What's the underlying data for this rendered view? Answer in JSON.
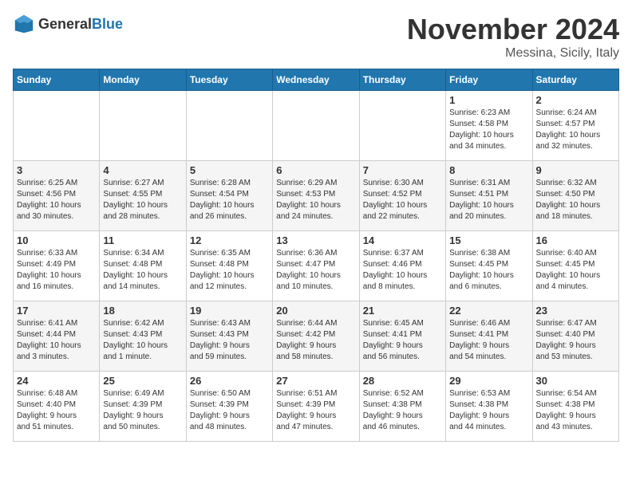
{
  "logo": {
    "text_general": "General",
    "text_blue": "Blue"
  },
  "title": "November 2024",
  "subtitle": "Messina, Sicily, Italy",
  "days_of_week": [
    "Sunday",
    "Monday",
    "Tuesday",
    "Wednesday",
    "Thursday",
    "Friday",
    "Saturday"
  ],
  "weeks": [
    [
      {
        "day": "",
        "lines": []
      },
      {
        "day": "",
        "lines": []
      },
      {
        "day": "",
        "lines": []
      },
      {
        "day": "",
        "lines": []
      },
      {
        "day": "",
        "lines": []
      },
      {
        "day": "1",
        "lines": [
          "Sunrise: 6:23 AM",
          "Sunset: 4:58 PM",
          "Daylight: 10 hours",
          "and 34 minutes."
        ]
      },
      {
        "day": "2",
        "lines": [
          "Sunrise: 6:24 AM",
          "Sunset: 4:57 PM",
          "Daylight: 10 hours",
          "and 32 minutes."
        ]
      }
    ],
    [
      {
        "day": "3",
        "lines": [
          "Sunrise: 6:25 AM",
          "Sunset: 4:56 PM",
          "Daylight: 10 hours",
          "and 30 minutes."
        ]
      },
      {
        "day": "4",
        "lines": [
          "Sunrise: 6:27 AM",
          "Sunset: 4:55 PM",
          "Daylight: 10 hours",
          "and 28 minutes."
        ]
      },
      {
        "day": "5",
        "lines": [
          "Sunrise: 6:28 AM",
          "Sunset: 4:54 PM",
          "Daylight: 10 hours",
          "and 26 minutes."
        ]
      },
      {
        "day": "6",
        "lines": [
          "Sunrise: 6:29 AM",
          "Sunset: 4:53 PM",
          "Daylight: 10 hours",
          "and 24 minutes."
        ]
      },
      {
        "day": "7",
        "lines": [
          "Sunrise: 6:30 AM",
          "Sunset: 4:52 PM",
          "Daylight: 10 hours",
          "and 22 minutes."
        ]
      },
      {
        "day": "8",
        "lines": [
          "Sunrise: 6:31 AM",
          "Sunset: 4:51 PM",
          "Daylight: 10 hours",
          "and 20 minutes."
        ]
      },
      {
        "day": "9",
        "lines": [
          "Sunrise: 6:32 AM",
          "Sunset: 4:50 PM",
          "Daylight: 10 hours",
          "and 18 minutes."
        ]
      }
    ],
    [
      {
        "day": "10",
        "lines": [
          "Sunrise: 6:33 AM",
          "Sunset: 4:49 PM",
          "Daylight: 10 hours",
          "and 16 minutes."
        ]
      },
      {
        "day": "11",
        "lines": [
          "Sunrise: 6:34 AM",
          "Sunset: 4:48 PM",
          "Daylight: 10 hours",
          "and 14 minutes."
        ]
      },
      {
        "day": "12",
        "lines": [
          "Sunrise: 6:35 AM",
          "Sunset: 4:48 PM",
          "Daylight: 10 hours",
          "and 12 minutes."
        ]
      },
      {
        "day": "13",
        "lines": [
          "Sunrise: 6:36 AM",
          "Sunset: 4:47 PM",
          "Daylight: 10 hours",
          "and 10 minutes."
        ]
      },
      {
        "day": "14",
        "lines": [
          "Sunrise: 6:37 AM",
          "Sunset: 4:46 PM",
          "Daylight: 10 hours",
          "and 8 minutes."
        ]
      },
      {
        "day": "15",
        "lines": [
          "Sunrise: 6:38 AM",
          "Sunset: 4:45 PM",
          "Daylight: 10 hours",
          "and 6 minutes."
        ]
      },
      {
        "day": "16",
        "lines": [
          "Sunrise: 6:40 AM",
          "Sunset: 4:45 PM",
          "Daylight: 10 hours",
          "and 4 minutes."
        ]
      }
    ],
    [
      {
        "day": "17",
        "lines": [
          "Sunrise: 6:41 AM",
          "Sunset: 4:44 PM",
          "Daylight: 10 hours",
          "and 3 minutes."
        ]
      },
      {
        "day": "18",
        "lines": [
          "Sunrise: 6:42 AM",
          "Sunset: 4:43 PM",
          "Daylight: 10 hours",
          "and 1 minute."
        ]
      },
      {
        "day": "19",
        "lines": [
          "Sunrise: 6:43 AM",
          "Sunset: 4:43 PM",
          "Daylight: 9 hours",
          "and 59 minutes."
        ]
      },
      {
        "day": "20",
        "lines": [
          "Sunrise: 6:44 AM",
          "Sunset: 4:42 PM",
          "Daylight: 9 hours",
          "and 58 minutes."
        ]
      },
      {
        "day": "21",
        "lines": [
          "Sunrise: 6:45 AM",
          "Sunset: 4:41 PM",
          "Daylight: 9 hours",
          "and 56 minutes."
        ]
      },
      {
        "day": "22",
        "lines": [
          "Sunrise: 6:46 AM",
          "Sunset: 4:41 PM",
          "Daylight: 9 hours",
          "and 54 minutes."
        ]
      },
      {
        "day": "23",
        "lines": [
          "Sunrise: 6:47 AM",
          "Sunset: 4:40 PM",
          "Daylight: 9 hours",
          "and 53 minutes."
        ]
      }
    ],
    [
      {
        "day": "24",
        "lines": [
          "Sunrise: 6:48 AM",
          "Sunset: 4:40 PM",
          "Daylight: 9 hours",
          "and 51 minutes."
        ]
      },
      {
        "day": "25",
        "lines": [
          "Sunrise: 6:49 AM",
          "Sunset: 4:39 PM",
          "Daylight: 9 hours",
          "and 50 minutes."
        ]
      },
      {
        "day": "26",
        "lines": [
          "Sunrise: 6:50 AM",
          "Sunset: 4:39 PM",
          "Daylight: 9 hours",
          "and 48 minutes."
        ]
      },
      {
        "day": "27",
        "lines": [
          "Sunrise: 6:51 AM",
          "Sunset: 4:39 PM",
          "Daylight: 9 hours",
          "and 47 minutes."
        ]
      },
      {
        "day": "28",
        "lines": [
          "Sunrise: 6:52 AM",
          "Sunset: 4:38 PM",
          "Daylight: 9 hours",
          "and 46 minutes."
        ]
      },
      {
        "day": "29",
        "lines": [
          "Sunrise: 6:53 AM",
          "Sunset: 4:38 PM",
          "Daylight: 9 hours",
          "and 44 minutes."
        ]
      },
      {
        "day": "30",
        "lines": [
          "Sunrise: 6:54 AM",
          "Sunset: 4:38 PM",
          "Daylight: 9 hours",
          "and 43 minutes."
        ]
      }
    ]
  ]
}
